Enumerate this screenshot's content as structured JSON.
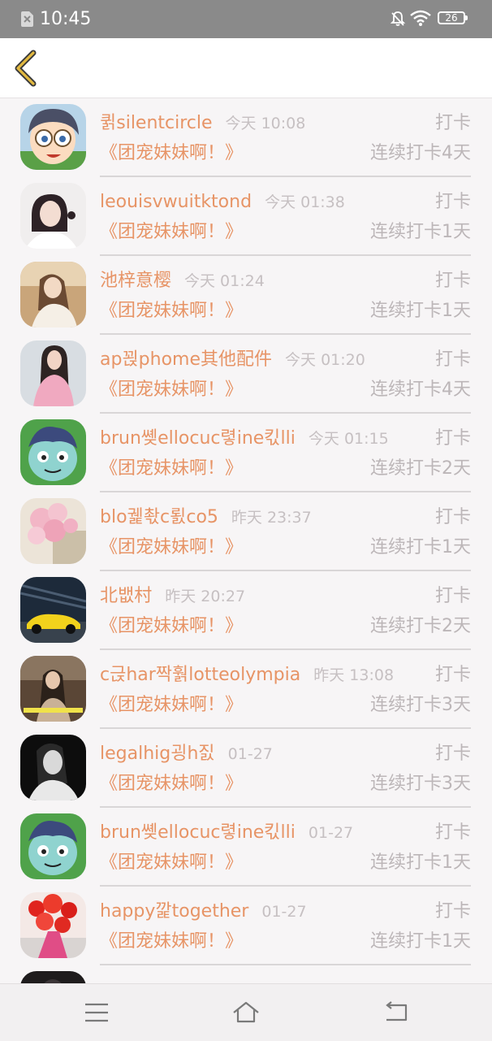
{
  "status_bar": {
    "time": "10:45",
    "battery": "26"
  },
  "header": {
    "back_icon": "chevron-left-icon",
    "accent_color": "#e2b940"
  },
  "list": {
    "colors": {
      "name": "#e79466",
      "muted": "#bcb6b8"
    },
    "rows": [
      {
        "name": "퀽silentcircle",
        "timestamp": "今天 10:08",
        "action": "打卡",
        "group": "《团宠妹妹啊！》",
        "streak": "连续打卡4天",
        "avatar": "cartoon-boy-glasses"
      },
      {
        "name": "leouisvwuitktond",
        "timestamp": "今天 01:38",
        "action": "打卡",
        "group": "《团宠妹妹啊！》",
        "streak": "连续打卡1天",
        "avatar": "woman-dark-hair"
      },
      {
        "name": "池梓意樱",
        "timestamp": "今天 01:24",
        "action": "打卡",
        "group": "《团宠妹妹啊！》",
        "streak": "连续打卡1天",
        "avatar": "girl-warm-tone"
      },
      {
        "name": "ap꾅phome其他配件",
        "timestamp": "今天 01:20",
        "action": "打卡",
        "group": "《团宠妹妹啊！》",
        "streak": "连续打卡4天",
        "avatar": "woman-pink"
      },
      {
        "name": "brun쏒ellocuc렿ine킧lli",
        "timestamp": "今天 01:15",
        "action": "打卡",
        "group": "《团宠妹妹啊！》",
        "streak": "连续打卡2天",
        "avatar": "cartoon-monster"
      },
      {
        "name": "blo궱촧c뢼co5",
        "timestamp": "昨天 23:37",
        "action": "打卡",
        "group": "《团宠妹妹啊！》",
        "streak": "连续打卡1天",
        "avatar": "pink-balloons"
      },
      {
        "name": "北뱂村",
        "timestamp": "昨天 20:27",
        "action": "打卡",
        "group": "《团宠妹妹啊！》",
        "streak": "连续打卡2天",
        "avatar": "yellow-car"
      },
      {
        "name": "c귽har짝훩lotteolympia",
        "timestamp": "昨天 13:08",
        "action": "打卡",
        "group": "《团宠妹妹啊！》",
        "streak": "连续打卡3天",
        "avatar": "girl-sepia"
      },
      {
        "name": "legalhig굉h짌",
        "timestamp": "01-27",
        "action": "打卡",
        "group": "《团宠妹妹啊！》",
        "streak": "连续打卡3天",
        "avatar": "bw-portrait"
      },
      {
        "name": "brun쏒ellocuc렿ine킧lli",
        "timestamp": "01-27",
        "action": "打卡",
        "group": "《团宠妹妹啊！》",
        "streak": "连续打卡1天",
        "avatar": "cartoon-monster"
      },
      {
        "name": "happy깙together",
        "timestamp": "01-27",
        "action": "打卡",
        "group": "《团宠妹妹啊！》",
        "streak": "连续打卡1天",
        "avatar": "red-flowers"
      }
    ]
  },
  "nav_bar": {
    "menu_icon": "menu-icon",
    "home_icon": "home-icon",
    "back_icon": "back-arrow-icon"
  }
}
